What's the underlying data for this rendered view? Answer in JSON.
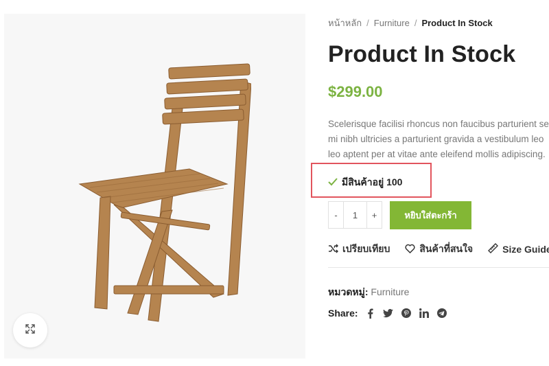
{
  "breadcrumb": {
    "home": "หน้าหลัก",
    "category": "Furniture",
    "current": "Product In Stock"
  },
  "product": {
    "title": "Product In Stock",
    "price": "$299.00",
    "description_lines": [
      "Scelerisque facilisi rhoncus non faucibus parturient se",
      "mi nibh ultricies a parturient gravida a vestibulum leo",
      "leo aptent per at vitae ante eleifend mollis adipiscing."
    ],
    "stock": "มีสินค้าอยู่ 100"
  },
  "quantity": {
    "minus": "-",
    "value": "1",
    "plus": "+"
  },
  "add_to_cart": "หยิบใส่ตะกร้า",
  "actions": {
    "compare": "เปรียบเทียบ",
    "wishlist": "สินค้าที่สนใจ",
    "size_guide": "Size Guide"
  },
  "meta": {
    "category_label": "หมวดหมู่:",
    "category_value": "Furniture",
    "share_label": "Share:"
  },
  "icons": {
    "zoom": "expand-icon",
    "check": "check-icon",
    "compare": "shuffle-icon",
    "wishlist": "heart-icon",
    "size_guide": "ruler-icon",
    "share": [
      "facebook-icon",
      "twitter-icon",
      "pinterest-icon",
      "linkedin-icon",
      "telegram-icon"
    ]
  },
  "colors": {
    "price": "#7cb342",
    "cart_button": "#83b735",
    "highlight_border": "#e2545d"
  }
}
